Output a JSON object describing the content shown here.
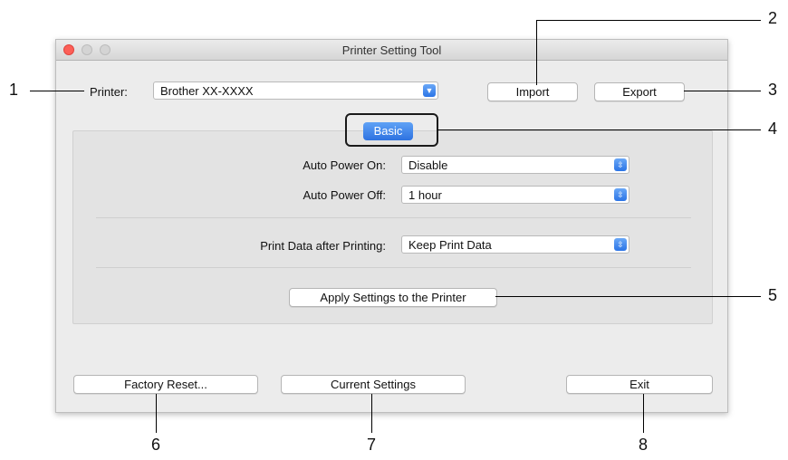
{
  "window": {
    "title": "Printer Setting Tool"
  },
  "printer": {
    "label": "Printer:",
    "value": "Brother XX-XXXX"
  },
  "header_buttons": {
    "import": "Import",
    "export": "Export"
  },
  "tab": {
    "basic": "Basic"
  },
  "settings": {
    "auto_power_on": {
      "label": "Auto Power On:",
      "value": "Disable"
    },
    "auto_power_off": {
      "label": "Auto Power Off:",
      "value": "1 hour"
    },
    "print_data": {
      "label": "Print Data after Printing:",
      "value": "Keep Print Data"
    }
  },
  "apply_button": "Apply Settings to the Printer",
  "footer_buttons": {
    "factory_reset": "Factory Reset...",
    "current_settings": "Current Settings",
    "exit": "Exit"
  },
  "callouts": [
    "1",
    "2",
    "3",
    "4",
    "5",
    "6",
    "7",
    "8"
  ]
}
